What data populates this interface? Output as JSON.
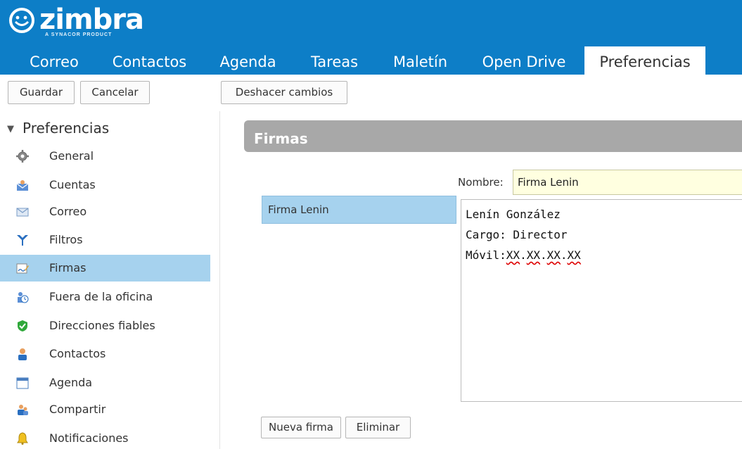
{
  "header": {
    "logo_text": "zimbra",
    "logo_sub": "A SYNACOR PRODUCT",
    "tabs": [
      {
        "label": "Correo"
      },
      {
        "label": "Contactos"
      },
      {
        "label": "Agenda"
      },
      {
        "label": "Tareas"
      },
      {
        "label": "Maletín"
      },
      {
        "label": "Open Drive"
      },
      {
        "label": "Preferencias"
      }
    ],
    "active_tab": "Preferencias"
  },
  "toolbar": {
    "save_label": "Guardar",
    "cancel_label": "Cancelar",
    "undo_label": "Deshacer cambios"
  },
  "sidebar": {
    "root_label": "Preferencias",
    "items": [
      {
        "label": "General",
        "icon": "gear-icon"
      },
      {
        "label": "Cuentas",
        "icon": "accounts-icon"
      },
      {
        "label": "Correo",
        "icon": "envelope-icon"
      },
      {
        "label": "Filtros",
        "icon": "filter-icon"
      },
      {
        "label": "Firmas",
        "icon": "signature-icon"
      },
      {
        "label": "Fuera de la oficina",
        "icon": "out-of-office-icon"
      },
      {
        "label": "Direcciones fiables",
        "icon": "shield-icon"
      },
      {
        "label": "Contactos",
        "icon": "contact-icon"
      },
      {
        "label": "Agenda",
        "icon": "calendar-icon"
      },
      {
        "label": "Compartir",
        "icon": "share-icon"
      },
      {
        "label": "Notificaciones",
        "icon": "bell-icon"
      }
    ],
    "active_item": "Firmas"
  },
  "main": {
    "section_title": "Firmas",
    "name_label": "Nombre:",
    "name_value": "Firma Lenin",
    "signatures": [
      {
        "label": "Firma Lenin"
      }
    ],
    "editor_lines": [
      "Lenín González",
      "Cargo: Director",
      "Móvil:XX.XX.XX.XX"
    ],
    "new_signature_label": "Nueva firma",
    "delete_label": "Eliminar"
  },
  "colors": {
    "header_blue": "#0d7ec7",
    "selection_blue": "#a6d2ee",
    "section_gray": "#a8a8a8",
    "input_yellow": "#ffffe0"
  }
}
